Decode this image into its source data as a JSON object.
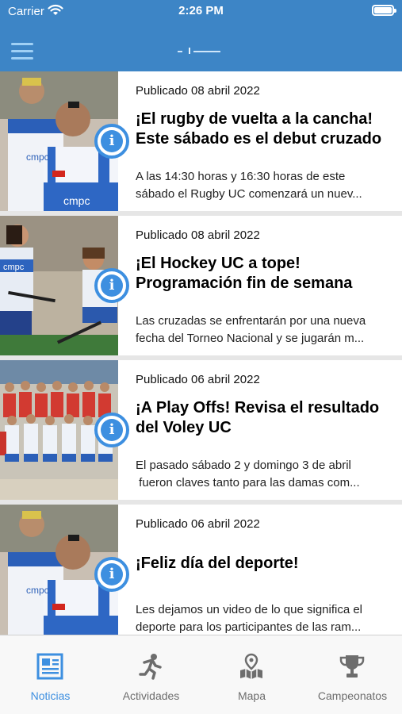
{
  "status_bar": {
    "carrier": "Carrier",
    "time": "2:26 PM"
  },
  "header": {
    "menu_icon": "hamburger-menu-icon",
    "logo": "app-logo"
  },
  "news": [
    {
      "date": "Publicado 08 abril 2022",
      "title_lines": [
        "¡El rugby de vuelta a la cancha!",
        "Este sábado es el debut cruzado"
      ],
      "excerpt_lines": [
        "A las 14:30 horas y 16:30 horas de este",
        "sábado el Rugby UC comenzará un nuev..."
      ],
      "thumbnail": "rugby-players-photo",
      "jersey_text": "cmpc"
    },
    {
      "date": "Publicado 08 abril 2022",
      "title_lines": [
        "¡El Hockey UC a tope!",
        "Programación fin de semana"
      ],
      "excerpt_lines": [
        "Las cruzadas se enfrentarán por una nueva",
        "fecha del Torneo Nacional y se jugarán m..."
      ],
      "thumbnail": "hockey-players-photo",
      "jersey_text": "cmpc"
    },
    {
      "date": "Publicado 06 abril 2022",
      "title_lines": [
        "¡A Play Offs! Revisa el resultado",
        "del Voley UC"
      ],
      "excerpt_lines": [
        "El pasado sábado 2 y domingo 3 de abril",
        " fueron claves tanto para las damas com..."
      ],
      "thumbnail": "volleyball-team-photo",
      "jersey_text": ""
    },
    {
      "date": "Publicado 06 abril 2022",
      "title_lines": [
        "¡Feliz día del deporte!"
      ],
      "excerpt_lines": [
        "Les dejamos un video de lo que significa el",
        "deporte para los participantes de las ram..."
      ],
      "thumbnail": "rugby-players-photo",
      "jersey_text": "cmpc"
    }
  ],
  "tabs": [
    {
      "label": "Noticias",
      "icon": "newspaper-icon",
      "active": true
    },
    {
      "label": "Actividades",
      "icon": "running-person-icon",
      "active": false
    },
    {
      "label": "Mapa",
      "icon": "map-pin-icon",
      "active": false
    },
    {
      "label": "Campeonatos",
      "icon": "trophy-icon",
      "active": false
    }
  ],
  "colors": {
    "header": "#3d85c6",
    "accent": "#3d8fe0",
    "tab_inactive": "#6d6d6d"
  }
}
